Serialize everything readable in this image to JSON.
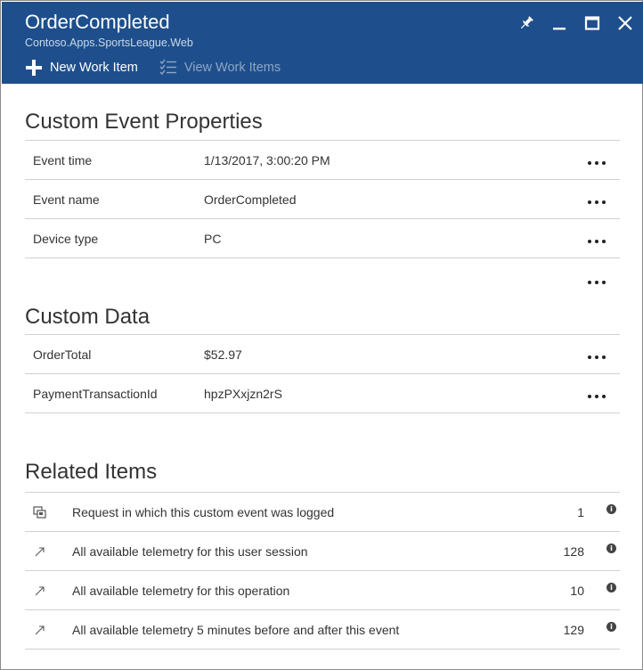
{
  "header": {
    "title": "OrderCompleted",
    "subtitle": "Contoso.Apps.SportsLeague.Web",
    "window_icons": [
      "pin-icon",
      "minimize-icon",
      "maximize-icon",
      "close-icon"
    ],
    "toolbar": {
      "new_work_item": "New Work Item",
      "view_work_items": "View Work Items"
    },
    "colors": {
      "header_bg": "#1e4f8c",
      "disabled_text": "#8ea6c6"
    }
  },
  "custom_event_properties": {
    "title": "Custom Event Properties",
    "rows": [
      {
        "key": "Event time",
        "value": "1/13/2017, 3:00:20 PM"
      },
      {
        "key": "Event name",
        "value": "OrderCompleted"
      },
      {
        "key": "Device type",
        "value": "PC"
      }
    ]
  },
  "custom_data": {
    "title": "Custom Data",
    "rows": [
      {
        "key": "OrderTotal",
        "value": "$52.97"
      },
      {
        "key": "PaymentTransactionId",
        "value": "hpzPXxjzn2rS"
      }
    ]
  },
  "related_items": {
    "title": "Related Items",
    "rows": [
      {
        "icon": "request-icon",
        "label": "Request in which this custom event was logged",
        "count": "1"
      },
      {
        "icon": "arrow-link-icon",
        "label": "All available telemetry for this user session",
        "count": "128"
      },
      {
        "icon": "arrow-link-icon",
        "label": "All available telemetry for this operation",
        "count": "10"
      },
      {
        "icon": "arrow-link-icon",
        "label": "All available telemetry 5 minutes before and after this event",
        "count": "129"
      }
    ]
  }
}
